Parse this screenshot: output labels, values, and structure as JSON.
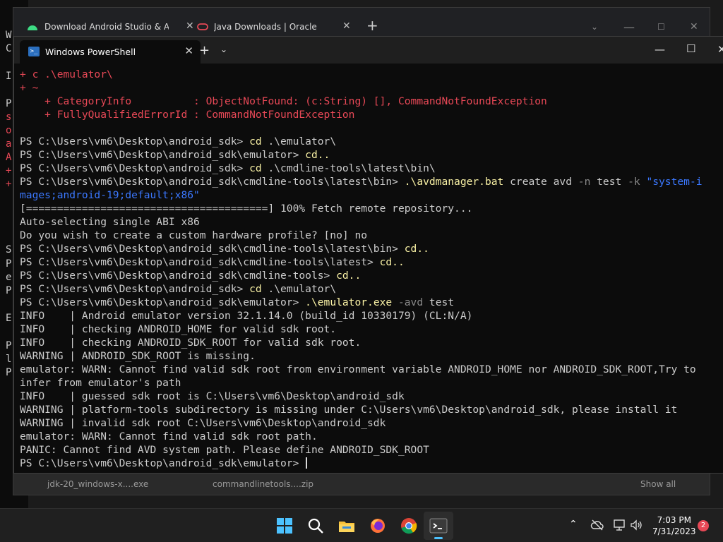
{
  "background_console": {
    "chars": [
      "W",
      "C",
      "I",
      "P",
      "s",
      "o",
      "a",
      "A",
      "+",
      "+",
      "S",
      "P",
      "e",
      "P",
      "E",
      "P",
      "l",
      "P"
    ]
  },
  "browser": {
    "tabs": [
      {
        "label": "Download Android Studio & App"
      },
      {
        "label": "Java Downloads | Oracle"
      }
    ],
    "downloads": [
      "jdk-20_windows-x....exe",
      "commandlinetools....zip",
      "Show all"
    ]
  },
  "powershell": {
    "tab_label": "Windows PowerShell",
    "lines": [
      [
        {
          "c": "red",
          "t": "+ c .\\emulator\\"
        }
      ],
      [
        {
          "c": "red",
          "t": "+ ~"
        }
      ],
      [
        {
          "c": "red",
          "t": "    + CategoryInfo          : ObjectNotFound: (c:String) [], CommandNotFoundException"
        }
      ],
      [
        {
          "c": "red",
          "t": "    + FullyQualifiedErrorId : CommandNotFoundException"
        }
      ],
      [
        {
          "c": "",
          "t": ""
        }
      ],
      [
        {
          "c": "",
          "t": "PS C:\\Users\\vm6\\Desktop\\android_sdk> "
        },
        {
          "c": "yel",
          "t": "cd"
        },
        {
          "c": "",
          "t": " .\\emulator\\"
        }
      ],
      [
        {
          "c": "",
          "t": "PS C:\\Users\\vm6\\Desktop\\android_sdk\\emulator> "
        },
        {
          "c": "yel",
          "t": "cd.."
        }
      ],
      [
        {
          "c": "",
          "t": "PS C:\\Users\\vm6\\Desktop\\android_sdk> "
        },
        {
          "c": "yel",
          "t": "cd"
        },
        {
          "c": "",
          "t": " .\\cmdline-tools\\latest\\bin\\"
        }
      ],
      [
        {
          "c": "",
          "t": "PS C:\\Users\\vm6\\Desktop\\android_sdk\\cmdline-tools\\latest\\bin> "
        },
        {
          "c": "yel",
          "t": ".\\avdmanager.bat"
        },
        {
          "c": "",
          "t": " create avd "
        },
        {
          "c": "gry",
          "t": "-n"
        },
        {
          "c": "",
          "t": " test "
        },
        {
          "c": "gry",
          "t": "-k"
        },
        {
          "c": "",
          "t": " "
        },
        {
          "c": "blu",
          "t": "\"system-i"
        }
      ],
      [
        {
          "c": "blu",
          "t": "mages;android-19;default;x86\""
        }
      ],
      [
        {
          "c": "",
          "t": "[=======================================] 100% Fetch remote repository..."
        }
      ],
      [
        {
          "c": "",
          "t": "Auto-selecting single ABI x86"
        }
      ],
      [
        {
          "c": "",
          "t": "Do you wish to create a custom hardware profile? [no] no"
        }
      ],
      [
        {
          "c": "",
          "t": "PS C:\\Users\\vm6\\Desktop\\android_sdk\\cmdline-tools\\latest\\bin> "
        },
        {
          "c": "yel",
          "t": "cd.."
        }
      ],
      [
        {
          "c": "",
          "t": "PS C:\\Users\\vm6\\Desktop\\android_sdk\\cmdline-tools\\latest> "
        },
        {
          "c": "yel",
          "t": "cd.."
        }
      ],
      [
        {
          "c": "",
          "t": "PS C:\\Users\\vm6\\Desktop\\android_sdk\\cmdline-tools> "
        },
        {
          "c": "yel",
          "t": "cd.."
        }
      ],
      [
        {
          "c": "",
          "t": "PS C:\\Users\\vm6\\Desktop\\android_sdk> "
        },
        {
          "c": "yel",
          "t": "cd"
        },
        {
          "c": "",
          "t": " .\\emulator\\"
        }
      ],
      [
        {
          "c": "",
          "t": "PS C:\\Users\\vm6\\Desktop\\android_sdk\\emulator> "
        },
        {
          "c": "yel",
          "t": ".\\emulator.exe"
        },
        {
          "c": "",
          "t": " "
        },
        {
          "c": "gry",
          "t": "-avd"
        },
        {
          "c": "",
          "t": " test"
        }
      ],
      [
        {
          "c": "",
          "t": "INFO    | Android emulator version 32.1.14.0 (build_id 10330179) (CL:N/A)"
        }
      ],
      [
        {
          "c": "",
          "t": "INFO    | checking ANDROID_HOME for valid sdk root."
        }
      ],
      [
        {
          "c": "",
          "t": "INFO    | checking ANDROID_SDK_ROOT for valid sdk root."
        }
      ],
      [
        {
          "c": "",
          "t": "WARNING | ANDROID_SDK_ROOT is missing."
        }
      ],
      [
        {
          "c": "",
          "t": "emulator: WARN: Cannot find valid sdk root from environment variable ANDROID_HOME nor ANDROID_SDK_ROOT,Try to"
        }
      ],
      [
        {
          "c": "",
          "t": "infer from emulator's path"
        }
      ],
      [
        {
          "c": "",
          "t": "INFO    | guessed sdk root is C:\\Users\\vm6\\Desktop\\android_sdk"
        }
      ],
      [
        {
          "c": "",
          "t": "WARNING | platform-tools subdirectory is missing under C:\\Users\\vm6\\Desktop\\android_sdk, please install it"
        }
      ],
      [
        {
          "c": "",
          "t": "WARNING | invalid sdk root C:\\Users\\vm6\\Desktop\\android_sdk"
        }
      ],
      [
        {
          "c": "",
          "t": "emulator: WARN: Cannot find valid sdk root path."
        }
      ],
      [
        {
          "c": "",
          "t": "PANIC: Cannot find AVD system path. Please define ANDROID_SDK_ROOT"
        }
      ],
      [
        {
          "c": "",
          "t": "PS C:\\Users\\vm6\\Desktop\\android_sdk\\emulator> "
        }
      ]
    ]
  },
  "taskbar": {
    "time": "7:03 PM",
    "date": "7/31/2023",
    "notification_count": "2",
    "icons": [
      "windows-start-icon",
      "search-icon",
      "file-explorer-icon",
      "firefox-icon",
      "chrome-icon",
      "terminal-icon"
    ]
  }
}
